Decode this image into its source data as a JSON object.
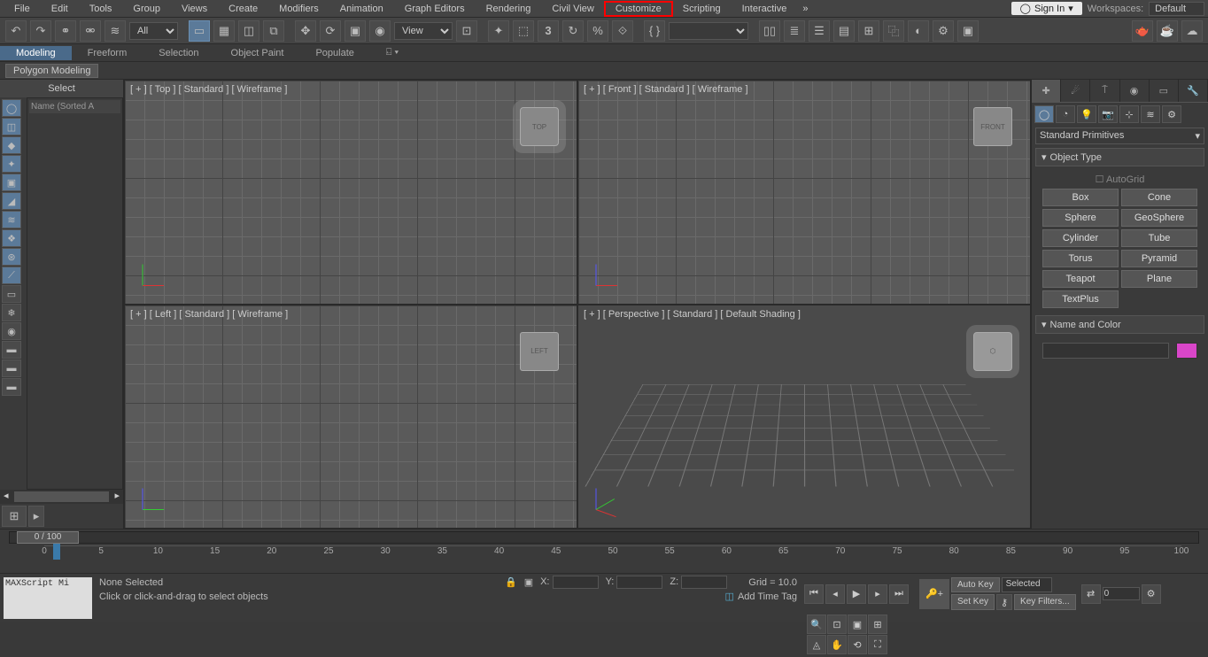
{
  "menubar": {
    "items": [
      "File",
      "Edit",
      "Tools",
      "Group",
      "Views",
      "Create",
      "Modifiers",
      "Animation",
      "Graph Editors",
      "Rendering",
      "Civil View",
      "Customize",
      "Scripting",
      "Interactive"
    ],
    "highlighted": "Customize",
    "signin": "Sign In",
    "workspaces_label": "Workspaces:",
    "workspace": "Default"
  },
  "toolbar": {
    "filter": "All",
    "view": "View"
  },
  "ribbon": {
    "tabs": [
      "Modeling",
      "Freeform",
      "Selection",
      "Object Paint",
      "Populate"
    ],
    "active": "Modeling",
    "sub": "Polygon Modeling"
  },
  "scene": {
    "header": "Select",
    "list_header": "Name (Sorted A"
  },
  "viewports": {
    "tl": "[ + ] [ Top ] [ Standard ] [ Wireframe ]",
    "tr": "[ + ] [ Front ] [ Standard ] [ Wireframe ]",
    "bl": "[ + ] [ Left ] [ Standard ] [ Wireframe ]",
    "br": "[ + ] [ Perspective ] [ Standard ] [ Default Shading ]",
    "cube_top": "TOP",
    "cube_front": "FRONT",
    "cube_left": "LEFT"
  },
  "cmd": {
    "category": "Standard Primitives",
    "rollout1": "Object Type",
    "autogrid": "AutoGrid",
    "buttons": [
      "Box",
      "Cone",
      "Sphere",
      "GeoSphere",
      "Cylinder",
      "Tube",
      "Torus",
      "Pyramid",
      "Teapot",
      "Plane",
      "TextPlus"
    ],
    "rollout2": "Name and Color"
  },
  "timeline": {
    "slider": "0 / 100",
    "ticks": [
      0,
      5,
      10,
      15,
      20,
      25,
      30,
      35,
      40,
      45,
      50,
      55,
      60,
      65,
      70,
      75,
      80,
      85,
      90,
      95,
      100
    ]
  },
  "status": {
    "script": "MAXScript Mi",
    "sel": "None Selected",
    "prompt": "Click or click-and-drag to select objects",
    "x": "X:",
    "y": "Y:",
    "z": "Z:",
    "grid": "Grid = 10.0",
    "add_tag": "Add Time Tag",
    "frame": "0",
    "autokey": "Auto Key",
    "setkey": "Set Key",
    "selected": "Selected",
    "keyfilters": "Key Filters..."
  }
}
